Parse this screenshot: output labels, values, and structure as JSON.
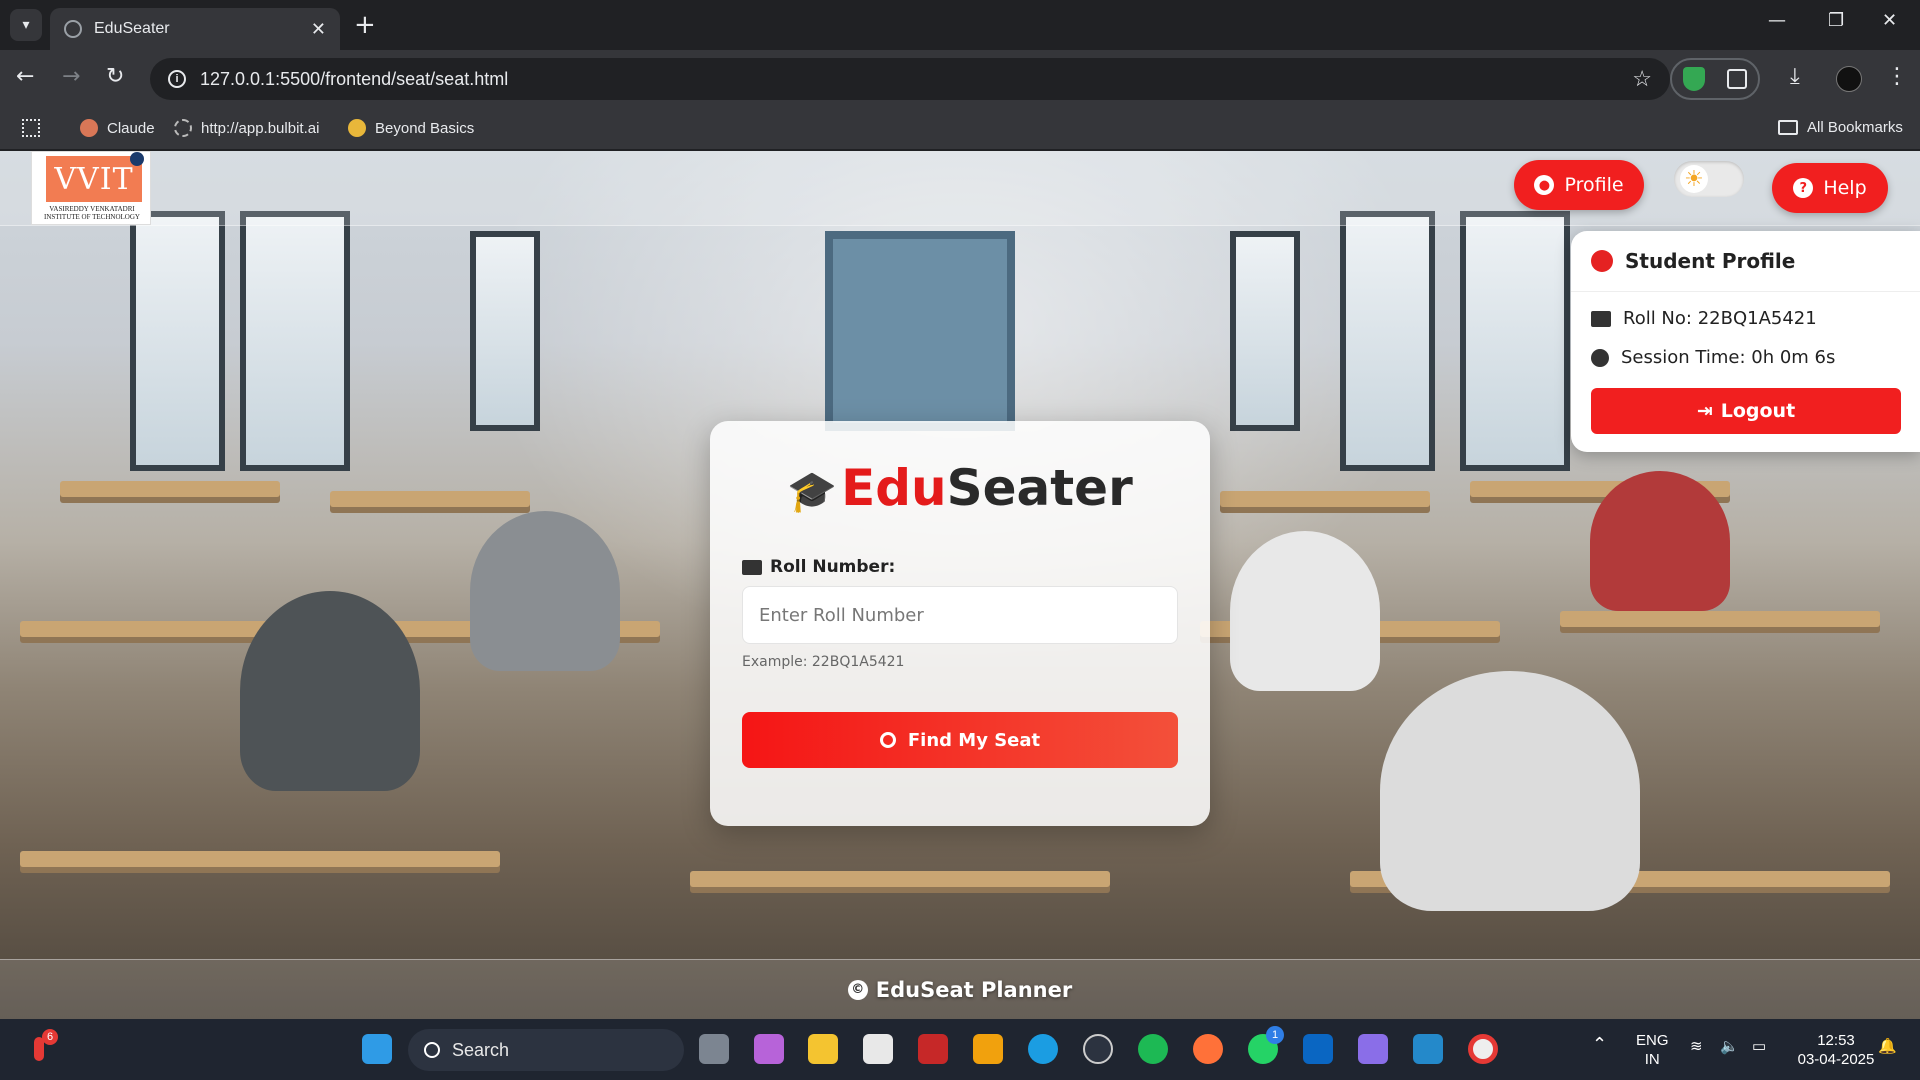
{
  "browser": {
    "tab_title": "EduSeater",
    "url": "127.0.0.1:5500/frontend/seat/seat.html",
    "bookmarks": [
      "Claude",
      "http://app.bulbit.ai",
      "Beyond Basics"
    ],
    "all_bookmarks": "All Bookmarks"
  },
  "navbar": {
    "logo_text": "VVIT",
    "logo_subtitle": "VASIREDDY VENKATADRI INSTITUTE OF TECHNOLOGY",
    "profile_label": "Profile",
    "help_label": "Help"
  },
  "profile_panel": {
    "title": "Student Profile",
    "roll_text": "Roll No: 22BQ1A5421",
    "session_text": "Session Time: 0h 0m 6s",
    "logout_label": "Logout"
  },
  "card": {
    "brand_edu": "Edu",
    "brand_seater": "Seater",
    "roll_label": "Roll Number:",
    "roll_placeholder": "Enter Roll Number",
    "roll_value": "",
    "hint": "Example: 22BQ1A5421",
    "find_label": "Find My Seat"
  },
  "footer": {
    "text": "EduSeat Planner"
  },
  "taskbar": {
    "search_label": "Search",
    "weather_badge": "6",
    "whatsapp_badge": "1",
    "lang_top": "ENG",
    "lang_bottom": "IN",
    "time": "12:53",
    "date": "03-04-2025"
  },
  "colors": {
    "accent_red": "#f11f1f",
    "brand_dark": "#2a2a2a"
  }
}
